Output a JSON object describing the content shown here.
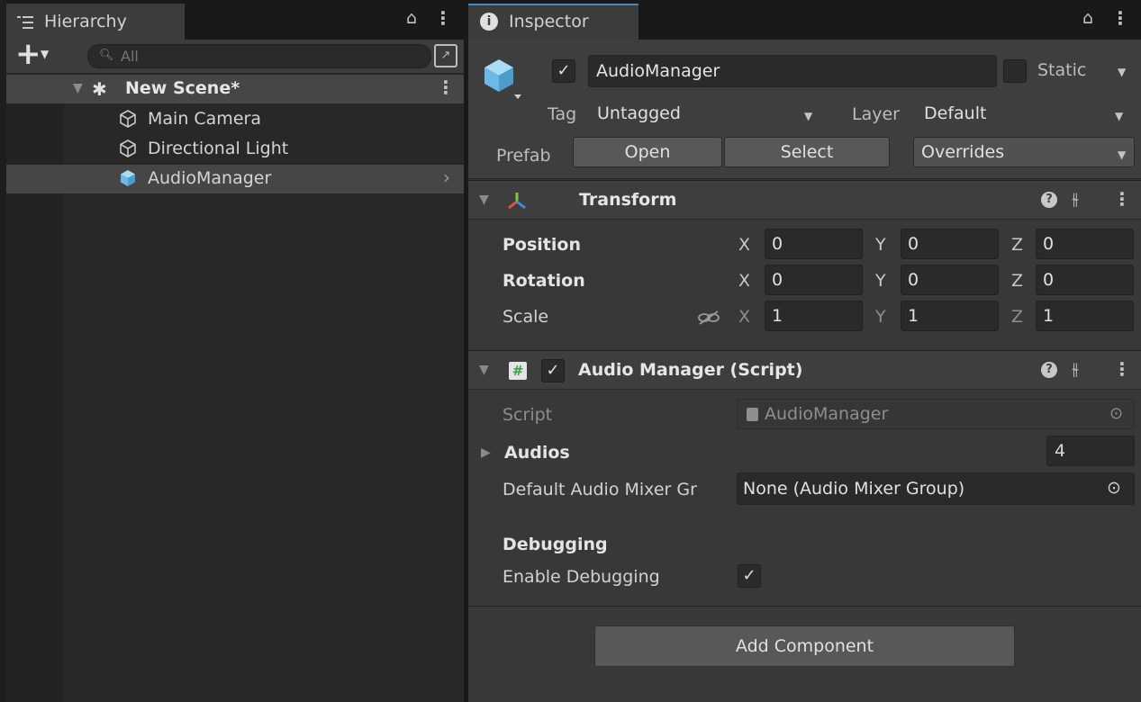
{
  "hierarchy": {
    "tab_label": "Hierarchy",
    "search_placeholder": "All",
    "scene": {
      "name": "New Scene*"
    },
    "items": [
      {
        "label": "Main Camera",
        "icon": "gameobject-outline-icon"
      },
      {
        "label": "Directional Light",
        "icon": "gameobject-outline-icon"
      },
      {
        "label": "AudioManager",
        "icon": "prefab-cube-icon",
        "selected": true
      }
    ]
  },
  "inspector": {
    "tab_label": "Inspector",
    "object": {
      "active": true,
      "name": "AudioManager",
      "static_label": "Static",
      "tag_label": "Tag",
      "tag_value": "Untagged",
      "layer_label": "Layer",
      "layer_value": "Default",
      "prefab_label": "Prefab",
      "open_label": "Open",
      "select_label": "Select",
      "overrides_label": "Overrides"
    },
    "transform": {
      "title": "Transform",
      "rows": [
        {
          "label": "Position",
          "x": "0",
          "y": "0",
          "z": "0"
        },
        {
          "label": "Rotation",
          "x": "0",
          "y": "0",
          "z": "0"
        },
        {
          "label": "Scale",
          "x": "1",
          "y": "1",
          "z": "1"
        }
      ],
      "axes": {
        "x": "X",
        "y": "Y",
        "z": "Z"
      }
    },
    "audio_manager": {
      "title": "Audio Manager (Script)",
      "enabled": true,
      "script_label": "Script",
      "script_value": "AudioManager",
      "audios_label": "Audios",
      "audios_count": "4",
      "mixer_label": "Default Audio Mixer Gr",
      "mixer_value": "None (Audio Mixer Group)",
      "debug_header": "Debugging",
      "enable_debug_label": "Enable Debugging",
      "enable_debug": true
    },
    "add_component_label": "Add Component"
  },
  "colors": {
    "selection_blue_tab": "#4a8ac4",
    "prefab_icon": "#6cb8e6",
    "transform_icon_red": "#e0533c",
    "transform_icon_green": "#7ac943",
    "transform_icon_blue": "#3a8de0"
  }
}
